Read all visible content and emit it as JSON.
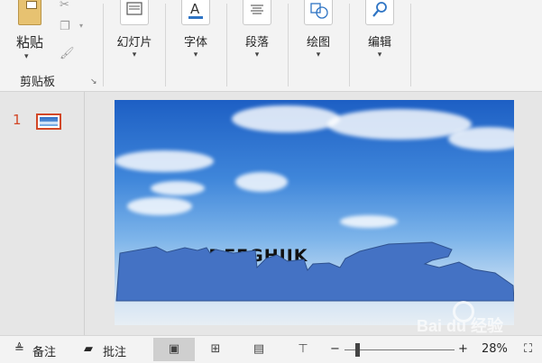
{
  "ribbon": {
    "paste_label": "粘贴",
    "clipboard_label": "剪贴板",
    "groups": [
      {
        "label": "幻灯片"
      },
      {
        "label": "字体"
      },
      {
        "label": "段落"
      },
      {
        "label": "绘图"
      },
      {
        "label": "编辑"
      }
    ]
  },
  "thumbnails": {
    "slide_number": "1"
  },
  "slide": {
    "text": "BCDEFGHIJK"
  },
  "status": {
    "notes_label": "备注",
    "comments_label": "批注",
    "zoom_minus": "−",
    "zoom_plus": "+",
    "zoom_level": "28%"
  },
  "watermark": {
    "text": "Bai du 经验"
  },
  "colors": {
    "accent": "#d24726",
    "wave_fill": "#4472c4",
    "ribbon_bg": "#f3f3f3"
  }
}
